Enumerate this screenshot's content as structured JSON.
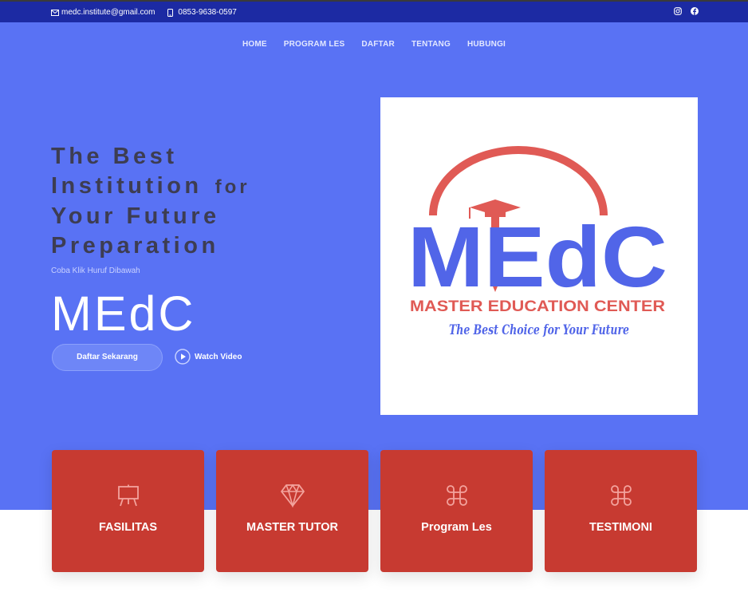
{
  "topbar": {
    "email": "medc.institute@gmail.com",
    "phone": "0853-9638-0597",
    "social_icons": [
      "instagram-icon",
      "facebook-icon"
    ]
  },
  "nav": {
    "items": [
      "HOME",
      "PROGRAM LES",
      "DAFTAR",
      "TENTANG",
      "HUBUNGI"
    ]
  },
  "hero": {
    "headline_line1": "The Best",
    "headline_line2a": "Institution",
    "headline_line2b": "for",
    "headline_line3": "Your Future",
    "headline_line4": "Preparation",
    "hint": "Coba Klik Huruf Dibawah",
    "big_word": "MEdC",
    "cta_label": "Daftar Sekarang",
    "video_label": "Watch Video"
  },
  "logo": {
    "letters": "MEdC",
    "name": "MASTER EDUCATION CENTER",
    "tagline": "The Best Choice for Your Future"
  },
  "cards": [
    {
      "label": "FASILITAS",
      "icon": "easel-icon"
    },
    {
      "label": "MASTER TUTOR",
      "icon": "diamond-icon"
    },
    {
      "label": "Program Les",
      "icon": "command-icon"
    },
    {
      "label": "TESTIMONI",
      "icon": "command-icon"
    }
  ],
  "colors": {
    "topbar": "#1c2aa3",
    "hero": "#5972f4",
    "card": "#c73a31",
    "headline": "#3d3d52",
    "logo_blue": "#5165e8",
    "logo_red": "#e05a55"
  }
}
